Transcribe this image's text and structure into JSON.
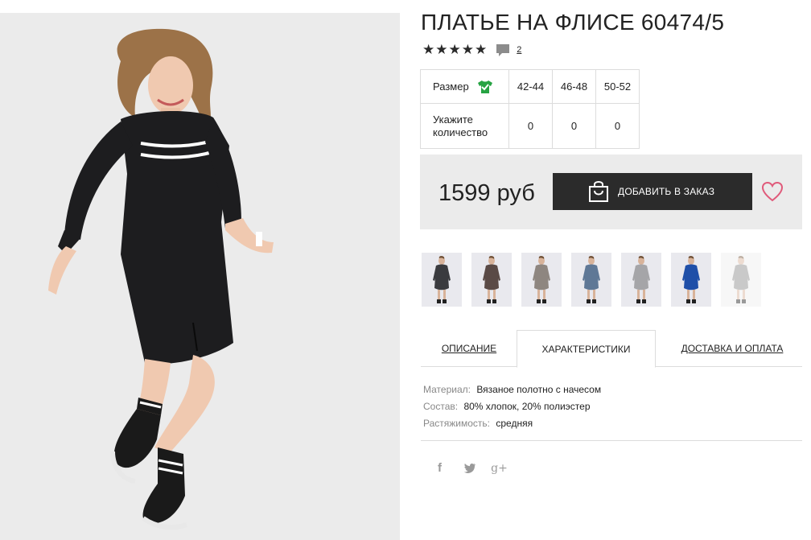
{
  "product": {
    "title": "ПЛАТЬЕ НА ФЛИСЕ 60474/5",
    "rating": 5,
    "review_count": "2"
  },
  "size_table": {
    "size_label": "Размер",
    "qty_label_line1": "Укажите",
    "qty_label_line2": "количество",
    "sizes": [
      "42-44",
      "46-48",
      "50-52"
    ],
    "quantities": [
      "0",
      "0",
      "0"
    ]
  },
  "buy": {
    "price": "1599 руб",
    "add_button": "ДОБАВИТЬ В ЗАКАЗ"
  },
  "thumbnails": [
    {
      "dress_color": "#3a3b3f",
      "bg": "#e9e9ee"
    },
    {
      "dress_color": "#5a4a46",
      "bg": "#e9e9ee"
    },
    {
      "dress_color": "#8e8680",
      "bg": "#e9e9ee"
    },
    {
      "dress_color": "#5f7896",
      "bg": "#e9e9ee"
    },
    {
      "dress_color": "#a5a5a8",
      "bg": "#e9e9ee"
    },
    {
      "dress_color": "#1f4fa8",
      "bg": "#e9e9ee"
    },
    {
      "dress_color": "#8a8a8a",
      "bg": "#eeeeee"
    }
  ],
  "tabs": {
    "description": "ОПИСАНИЕ",
    "characteristics": "ХАРАКТЕРИСТИКИ",
    "delivery": "ДОСТАВКА И ОПЛАТА"
  },
  "specs": [
    {
      "key": "Материал:",
      "value": "Вязаное полотно с начесом"
    },
    {
      "key": "Состав:",
      "value": "80% хлопок, 20% полиэстер"
    },
    {
      "key": "Растяжимость:",
      "value": "средняя"
    }
  ],
  "social": {
    "facebook": "f",
    "google_plus": "g+"
  },
  "colors": {
    "accent_heart": "#e05a7a",
    "button_bg": "#2b2b2b",
    "panel_bg": "#ebebeb",
    "check_green": "#27a343"
  }
}
